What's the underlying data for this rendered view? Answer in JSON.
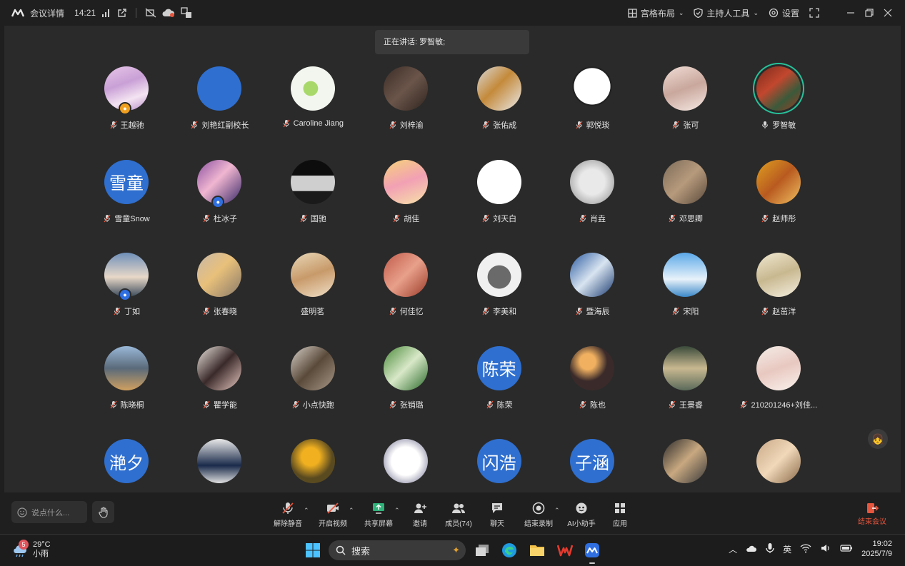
{
  "topbar": {
    "meeting_info": "会议详情",
    "time": "14:21",
    "layout": "宫格布局",
    "host_tools": "主持人工具",
    "settings": "设置"
  },
  "speaking": {
    "label": "正在讲话: 罗智敏;"
  },
  "participants": [
    {
      "name": "王越驰",
      "style": "linear-gradient(160deg,#e7c6e8,#c9a0d6 40%,#f4e4f2 70%,#b88fc9)",
      "text": "",
      "badge": "host",
      "speaker": false,
      "muted": true
    },
    {
      "name": "刘艳红副校长",
      "style": "#2f6fcf",
      "text": "",
      "badge": "",
      "speaker": false,
      "muted": true
    },
    {
      "name": "Caroline Jiang",
      "style": "radial-gradient(circle at 45% 50%,#a8d86a 0 22%,#f3f6ef 23%)",
      "text": "",
      "badge": "",
      "speaker": false,
      "muted": true
    },
    {
      "name": "刘梓渝",
      "style": "linear-gradient(135deg,#3a2c26,#6b554a 50%,#2e241f)",
      "text": "",
      "badge": "",
      "speaker": false,
      "muted": true
    },
    {
      "name": "张佑成",
      "style": "linear-gradient(135deg,#d9d9d9,#c48a3a 45%,#e9e9e9)",
      "text": "",
      "badge": "",
      "speaker": false,
      "muted": true
    },
    {
      "name": "郭悦琰",
      "style": "radial-gradient(circle at 50% 45%,#ffffff 0 55%,#222 56% 60%,#2a2a2a 61%)",
      "text": "",
      "badge": "",
      "speaker": false,
      "muted": true
    },
    {
      "name": "张可",
      "style": "linear-gradient(160deg,#f0ddd6,#c9a79c 50%,#f5e9e4)",
      "text": "",
      "badge": "",
      "speaker": false,
      "muted": true
    },
    {
      "name": "罗智敏",
      "style": "linear-gradient(140deg,#7a2a1c,#c2472e 40%,#3a5a3a 70%,#a33a24)",
      "text": "",
      "badge": "",
      "speaker": true,
      "muted": false
    },
    {
      "name": "雪童Snow",
      "style": "#2f6fcf",
      "text": "雪童",
      "badge": "",
      "speaker": false,
      "muted": true
    },
    {
      "name": "杜冰子",
      "style": "linear-gradient(135deg,#8a4fa0,#f0b6d0 45%,#3a2a6a)",
      "text": "",
      "badge": "member",
      "speaker": false,
      "muted": true
    },
    {
      "name": "国驰",
      "style": "linear-gradient(180deg,#0d0d0d 0 35%,#cfcfcf 36% 70%,#1a1a1a 71%)",
      "text": "",
      "badge": "",
      "speaker": false,
      "muted": true
    },
    {
      "name": "胡佳",
      "style": "linear-gradient(160deg,#f6d27a,#f2a0b4 50%,#f7e2a8)",
      "text": "",
      "badge": "",
      "speaker": false,
      "muted": true
    },
    {
      "name": "刘天白",
      "style": "#ffffff",
      "text": "",
      "badge": "",
      "speaker": false,
      "muted": true
    },
    {
      "name": "肖垚",
      "style": "radial-gradient(circle at 50% 50%,#e9e9e9 0 40%,#b9b9b9 70%)",
      "text": "",
      "badge": "",
      "speaker": false,
      "muted": true
    },
    {
      "name": "邓思卿",
      "style": "linear-gradient(135deg,#7a6a58,#b79a7c 50%,#5a4a3c)",
      "text": "",
      "badge": "",
      "speaker": false,
      "muted": true
    },
    {
      "name": "赵师彤",
      "style": "linear-gradient(135deg,#e0a020,#b85a20 50%,#f0c060)",
      "text": "",
      "badge": "",
      "speaker": false,
      "muted": true
    },
    {
      "name": "丁如",
      "style": "linear-gradient(180deg,#6e8fb8,#e8d8c8 55%,#3a4a5a)",
      "text": "",
      "badge": "member",
      "speaker": false,
      "muted": true
    },
    {
      "name": "张春晓",
      "style": "linear-gradient(135deg,#c8b8a8,#e8c07a 45%,#8a7a6a)",
      "text": "",
      "badge": "",
      "speaker": false,
      "muted": true
    },
    {
      "name": "盛明茗",
      "style": "linear-gradient(160deg,#e8d8b8,#c89a6a 50%,#f0e0c8)",
      "text": "",
      "badge": "",
      "speaker": false,
      "muted": false
    },
    {
      "name": "何佳忆",
      "style": "linear-gradient(135deg,#c05a4a,#e8a08a 50%,#9a3a2a)",
      "text": "",
      "badge": "",
      "speaker": false,
      "muted": true
    },
    {
      "name": "李美和",
      "style": "radial-gradient(circle at 50% 55%,#6a6a6a 0 35%,#f0f0f0 36%)",
      "text": "",
      "badge": "",
      "speaker": false,
      "muted": true
    },
    {
      "name": "暨海辰",
      "style": "linear-gradient(135deg,#2a5aa0,#d8e4f0 50%,#1a3a70)",
      "text": "",
      "badge": "",
      "speaker": false,
      "muted": true
    },
    {
      "name": "宋阳",
      "style": "linear-gradient(180deg,#5aa8e8,#e8f2fa 60%,#3a88c8)",
      "text": "",
      "badge": "",
      "speaker": false,
      "muted": true
    },
    {
      "name": "赵茁洋",
      "style": "linear-gradient(160deg,#f0e8d0,#c8b890 50%,#f5efe0)",
      "text": "",
      "badge": "",
      "speaker": false,
      "muted": true
    },
    {
      "name": "陈晓桐",
      "style": "linear-gradient(180deg,#9ab8d8,#5a6a7a 50%,#d0a060)",
      "text": "",
      "badge": "",
      "speaker": false,
      "muted": true
    },
    {
      "name": "瞿学能",
      "style": "linear-gradient(135deg,#f0e8e0,#3a2a2a 50%,#e8c8c0)",
      "text": "",
      "badge": "",
      "speaker": false,
      "muted": true
    },
    {
      "name": "小点快跑",
      "style": "linear-gradient(135deg,#d8d0c8,#5a4a3a 50%,#a89888)",
      "text": "",
      "badge": "",
      "speaker": false,
      "muted": true
    },
    {
      "name": "张销璐",
      "style": "linear-gradient(135deg,#4a8a3a,#d8e8c8 50%,#2a6a2a)",
      "text": "",
      "badge": "",
      "speaker": false,
      "muted": true
    },
    {
      "name": "陈荣",
      "style": "#2f6fcf",
      "text": "陈荣",
      "badge": "",
      "speaker": false,
      "muted": true
    },
    {
      "name": "陈也",
      "style": "radial-gradient(circle at 40% 35%,#f0b060 0 20%,#3a2a2a 50%)",
      "text": "",
      "badge": "",
      "speaker": false,
      "muted": true
    },
    {
      "name": "王景睿",
      "style": "linear-gradient(180deg,#3a4a3a,#c8b890 50%,#5a6a5a)",
      "text": "",
      "badge": "",
      "speaker": false,
      "muted": true
    },
    {
      "name": "210201246+刘佳...",
      "style": "linear-gradient(160deg,#f5ede8,#e8c8c0 50%,#faf2ee)",
      "text": "",
      "badge": "",
      "speaker": false,
      "muted": true
    },
    {
      "name": "滟夕",
      "style": "#2f6fcf",
      "text": "滟夕",
      "badge": "",
      "speaker": false,
      "muted": true
    },
    {
      "name": "",
      "style": "linear-gradient(180deg,#e8e8e8,#1a2a4a 60%,#e0e0e0)",
      "text": "",
      "badge": "",
      "speaker": false,
      "muted": true
    },
    {
      "name": "",
      "style": "radial-gradient(circle at 45% 40%,#f0b020 0 25%,#5a4a20 60%)",
      "text": "",
      "badge": "",
      "speaker": false,
      "muted": true
    },
    {
      "name": "",
      "style": "radial-gradient(circle at 50% 50%,#ffffff 0 45%,#b8b8c8 70%)",
      "text": "",
      "badge": "",
      "speaker": false,
      "muted": true
    },
    {
      "name": "",
      "style": "#2f6fcf",
      "text": "闪浩",
      "badge": "",
      "speaker": false,
      "muted": true
    },
    {
      "name": "",
      "style": "#2f6fcf",
      "text": "子涵",
      "badge": "",
      "speaker": false,
      "muted": true
    },
    {
      "name": "",
      "style": "linear-gradient(135deg,#2a2a2a,#c8a880 50%,#3a3a3a)",
      "text": "",
      "badge": "",
      "speaker": false,
      "muted": true
    },
    {
      "name": "",
      "style": "linear-gradient(135deg,#c8a888,#f0d8b8 50%,#8a6a4a)",
      "text": "",
      "badge": "",
      "speaker": false,
      "muted": true
    }
  ],
  "controls": {
    "say_placeholder": "说点什么...",
    "unmute": "解除静音",
    "start_video": "开启视频",
    "share_screen": "共享屏幕",
    "invite": "邀请",
    "members": "成员(74)",
    "chat": "聊天",
    "end_recording": "结束录制",
    "ai_assistant": "AI小助手",
    "apps": "应用",
    "end_meeting": "结束会议"
  },
  "taskbar": {
    "weather_badge": "5",
    "temperature": "29°C",
    "weather_desc": "小雨",
    "search_label": "搜索",
    "ime": "英",
    "clock_time": "19:02",
    "clock_date": "2025/7/9"
  },
  "colors": {
    "accent_blue": "#2f6fcf",
    "speaker_ring": "#27c29a",
    "end_red": "#e6553d"
  }
}
